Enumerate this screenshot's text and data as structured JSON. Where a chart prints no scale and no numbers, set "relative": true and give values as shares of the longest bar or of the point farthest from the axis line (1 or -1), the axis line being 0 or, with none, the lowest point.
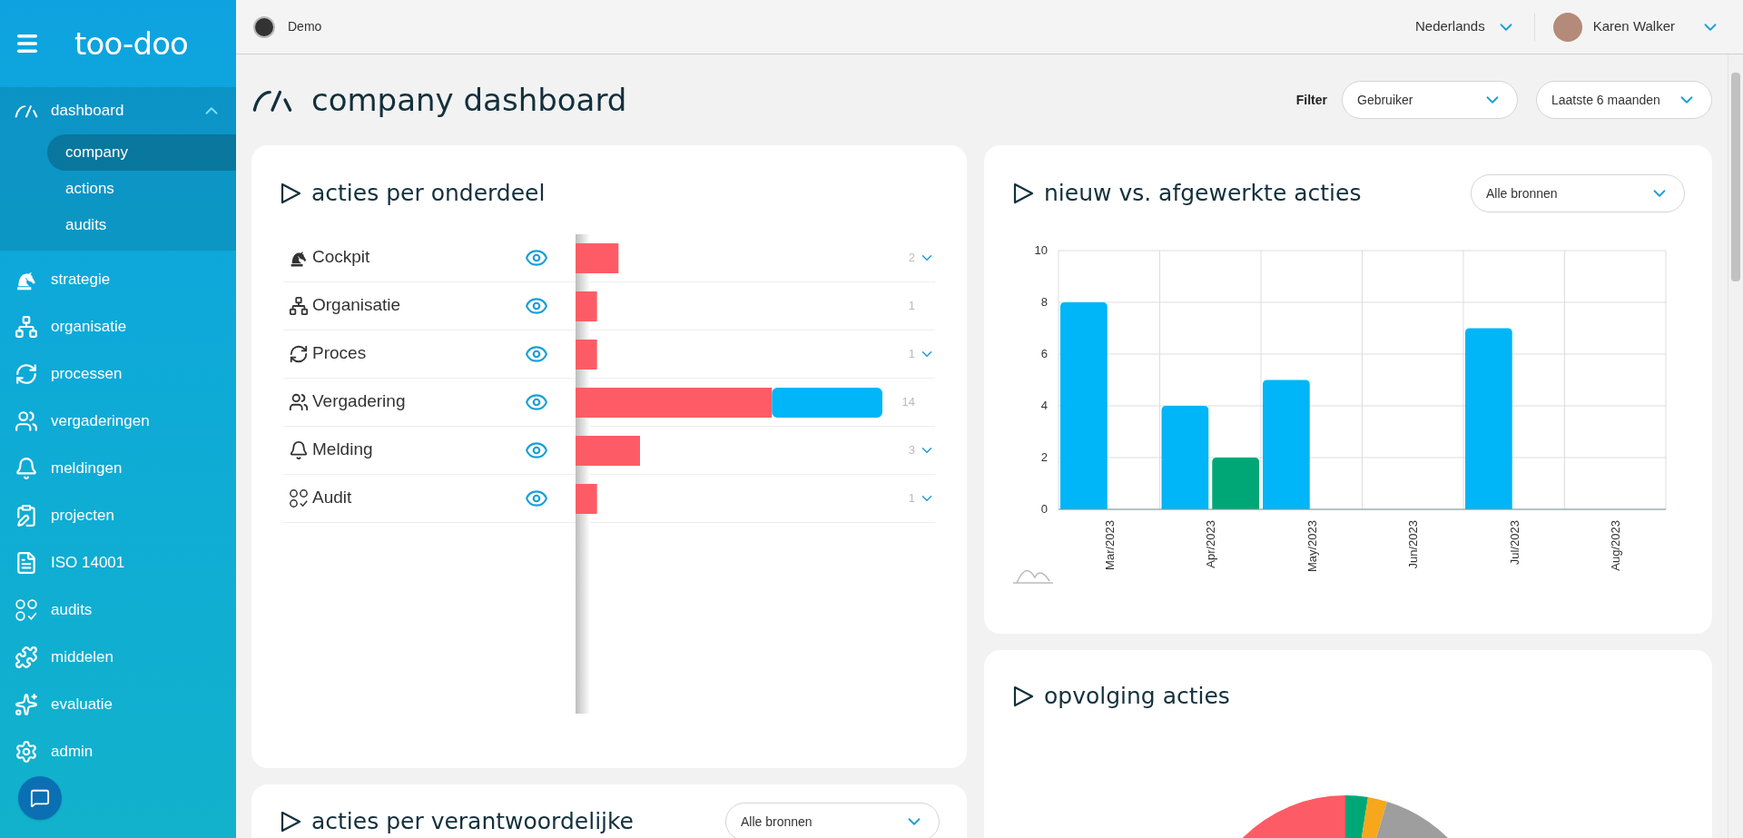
{
  "sidebar": {
    "logo": "too-doo",
    "items": [
      {
        "label": "dashboard",
        "expanded": true,
        "children": [
          {
            "label": "company",
            "selected": true
          },
          {
            "label": "actions",
            "selected": false
          },
          {
            "label": "audits",
            "selected": false
          }
        ]
      },
      {
        "label": "strategie"
      },
      {
        "label": "organisatie"
      },
      {
        "label": "processen"
      },
      {
        "label": "vergaderingen"
      },
      {
        "label": "meldingen"
      },
      {
        "label": "projecten"
      },
      {
        "label": "ISO 14001"
      },
      {
        "label": "audits"
      },
      {
        "label": "middelen"
      },
      {
        "label": "evaluatie"
      },
      {
        "label": "admin"
      }
    ]
  },
  "topbar": {
    "organization": "Demo",
    "language": "Nederlands",
    "user": "Karen Walker"
  },
  "page": {
    "title": "company dashboard",
    "filter_label": "Filter",
    "filters": [
      {
        "value": "Gebruiker"
      },
      {
        "value": "Laatste 6 maanden"
      }
    ]
  },
  "acties_per_onderdeel": {
    "title": "acties per onderdeel",
    "rows": [
      {
        "label": "Cockpit",
        "count": "2",
        "expandable": true
      },
      {
        "label": "Organisatie",
        "count": "1",
        "expandable": false
      },
      {
        "label": "Proces",
        "count": "1",
        "expandable": true
      },
      {
        "label": "Vergadering",
        "count": "14",
        "expandable": false
      },
      {
        "label": "Melding",
        "count": "3",
        "expandable": true
      },
      {
        "label": "Audit",
        "count": "1",
        "expandable": true
      }
    ],
    "chart_data": {
      "type": "bar",
      "orientation": "horizontal",
      "stacked": true,
      "relative": true,
      "series": [
        {
          "color": "#fd5c66",
          "values": [
            0.14,
            0.07,
            0.07,
            0.64,
            0.21,
            0.07
          ]
        },
        {
          "color": "#00b5f8",
          "values": [
            0,
            0,
            0,
            0.36,
            0,
            0
          ]
        }
      ]
    }
  },
  "nieuw_vs_afgewerkt": {
    "title": "nieuw vs. afgewerkte acties",
    "source_filter": "Alle bronnen",
    "chart_data": {
      "type": "bar",
      "categories": [
        "Mar/2023",
        "Apr/2023",
        "May/2023",
        "Jun/2023",
        "Jul/2023",
        "Aug/2023"
      ],
      "ylim": [
        0,
        10
      ],
      "grid": true,
      "yticks": [
        0,
        2,
        4,
        6,
        8,
        10
      ],
      "series": [
        {
          "color": "#00b5f8",
          "values": [
            8,
            4,
            5,
            0,
            7,
            0
          ]
        },
        {
          "color": "#00a776",
          "values": [
            0,
            2,
            0,
            0,
            0,
            0
          ]
        }
      ]
    }
  },
  "opvolging_acties": {
    "title": "opvolging acties"
  },
  "acties_per_verantwoordelijke": {
    "title": "acties per verantwoordelijke",
    "source_filter": "Alle bronnen"
  }
}
